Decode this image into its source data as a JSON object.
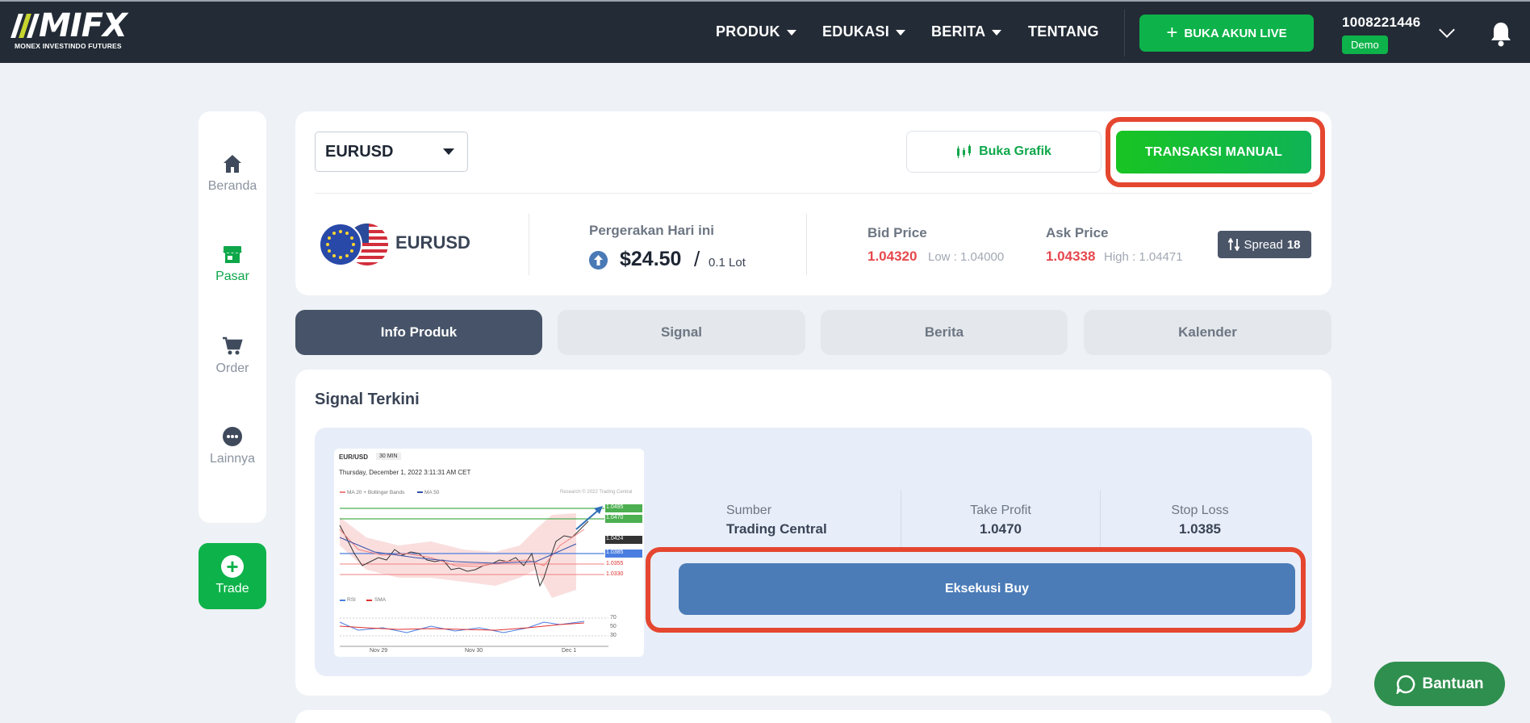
{
  "header": {
    "logo_text": "MIFX",
    "logo_subtitle": "MONEX INVESTINDO FUTURES",
    "nav": [
      {
        "label": "PRODUK",
        "has_dropdown": true
      },
      {
        "label": "EDUKASI",
        "has_dropdown": true
      },
      {
        "label": "BERITA",
        "has_dropdown": true
      },
      {
        "label": "TENTANG",
        "has_dropdown": false
      }
    ],
    "open_live_label": "BUKA AKUN LIVE",
    "account_number": "1008221446",
    "account_type": "Demo",
    "icons": {
      "open_live": "plus-icon",
      "account_menu": "chevron-down-icon",
      "notifications": "bell-icon"
    }
  },
  "sidebar": {
    "items": [
      {
        "label": "Beranda",
        "icon": "home-icon",
        "active": false
      },
      {
        "label": "Pasar",
        "icon": "store-icon",
        "active": true
      },
      {
        "label": "Order",
        "icon": "cart-icon",
        "active": false
      },
      {
        "label": "Lainnya",
        "icon": "more-icon",
        "active": false
      }
    ],
    "trade_label": "Trade"
  },
  "product": {
    "selected_symbol": "EURUSD",
    "open_chart_label": "Buka Grafik",
    "manual_trade_label": "TRANSAKSI MANUAL",
    "pair_name": "EURUSD",
    "movement_label": "Pergerakan Hari ini",
    "movement_value": "$24.50",
    "movement_slash": "/",
    "movement_lot": "0.1 Lot",
    "bid_label": "Bid Price",
    "bid_price": "1.04320",
    "bid_low": "Low : 1.04000",
    "ask_label": "Ask Price",
    "ask_price": "1.04338",
    "ask_high": "High : 1.04471",
    "spread_label": "Spread",
    "spread_value": "18",
    "colors": {
      "accent_green": "#0db34a",
      "price_red": "#e5484d",
      "exec_blue": "#4b7cb8",
      "highlight": "#e5462f"
    }
  },
  "tabs": [
    {
      "label": "Info Produk",
      "active": true
    },
    {
      "label": "Signal",
      "active": false
    },
    {
      "label": "Berita",
      "active": false
    },
    {
      "label": "Kalender",
      "active": false
    }
  ],
  "signal": {
    "title": "Signal Terkini",
    "chart_thumb": {
      "symbol": "EUR/USD",
      "timeframe": "30 MIN",
      "date": "Thursday, December 1, 2022 3:11:31 AM CET",
      "legend_ma20": "MA 20 + Bollinger Bands",
      "legend_ma50": "MA 50",
      "copyright": "Research © 2022 Trading Central",
      "levels": [
        "1.0495",
        "1.0470",
        "1.0424",
        "1.0385",
        "1.0355",
        "1.0330"
      ],
      "rsi_legend": "RSI",
      "sma_legend": "SMA",
      "rsi_ticks": [
        "70",
        "50",
        "30"
      ],
      "x_labels": [
        "Nov 29",
        "Nov 30",
        "Dec 1"
      ]
    },
    "source_label": "Sumber",
    "source_value": "Trading Central",
    "tp_label": "Take Profit",
    "tp_value": "1.0470",
    "sl_label": "Stop Loss",
    "sl_value": "1.0385",
    "execute_label": "Eksekusi Buy"
  },
  "help_label": "Bantuan"
}
